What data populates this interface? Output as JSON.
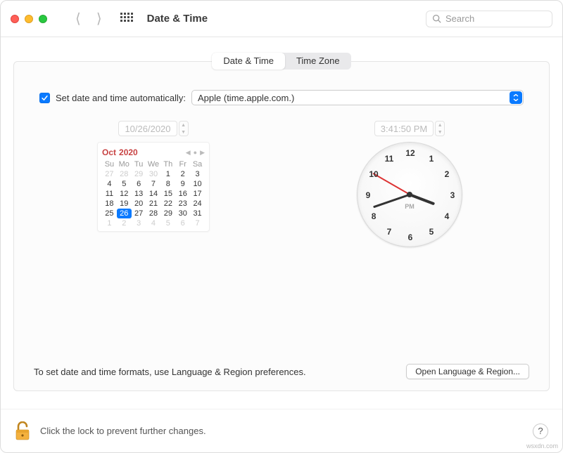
{
  "window": {
    "title": "Date & Time"
  },
  "search": {
    "placeholder": "Search"
  },
  "tabs": {
    "date_time": "Date & Time",
    "time_zone": "Time Zone"
  },
  "auto": {
    "label": "Set date and time automatically:",
    "server": "Apple (time.apple.com.)"
  },
  "date_field": "10/26/2020",
  "time_field": "3:41:50 PM",
  "calendar": {
    "month": "Oct",
    "year": "2020",
    "dow": [
      "Su",
      "Mo",
      "Tu",
      "We",
      "Th",
      "Fr",
      "Sa"
    ],
    "days": [
      {
        "n": "27",
        "m": true
      },
      {
        "n": "28",
        "m": true
      },
      {
        "n": "29",
        "m": true
      },
      {
        "n": "30",
        "m": true
      },
      {
        "n": "1"
      },
      {
        "n": "2"
      },
      {
        "n": "3"
      },
      {
        "n": "4"
      },
      {
        "n": "5"
      },
      {
        "n": "6"
      },
      {
        "n": "7"
      },
      {
        "n": "8"
      },
      {
        "n": "9"
      },
      {
        "n": "10"
      },
      {
        "n": "11"
      },
      {
        "n": "12"
      },
      {
        "n": "13"
      },
      {
        "n": "14"
      },
      {
        "n": "15"
      },
      {
        "n": "16"
      },
      {
        "n": "17"
      },
      {
        "n": "18"
      },
      {
        "n": "19"
      },
      {
        "n": "20"
      },
      {
        "n": "21"
      },
      {
        "n": "22"
      },
      {
        "n": "23"
      },
      {
        "n": "24"
      },
      {
        "n": "25"
      },
      {
        "n": "26",
        "sel": true
      },
      {
        "n": "27"
      },
      {
        "n": "28"
      },
      {
        "n": "29"
      },
      {
        "n": "30"
      },
      {
        "n": "31"
      },
      {
        "n": "1",
        "m": true
      },
      {
        "n": "2",
        "m": true
      },
      {
        "n": "3",
        "m": true
      },
      {
        "n": "4",
        "m": true
      },
      {
        "n": "5",
        "m": true
      },
      {
        "n": "6",
        "m": true
      },
      {
        "n": "7",
        "m": true
      }
    ]
  },
  "clock": {
    "numbers": [
      "12",
      "1",
      "2",
      "3",
      "4",
      "5",
      "6",
      "7",
      "8",
      "9",
      "10",
      "11"
    ],
    "ampm": "PM"
  },
  "formats_hint": "To set date and time formats, use Language & Region preferences.",
  "open_lang_region": "Open Language & Region...",
  "footer": {
    "lock_text": "Click the lock to prevent further changes."
  },
  "help": "?",
  "watermark": "wsxdn.com"
}
